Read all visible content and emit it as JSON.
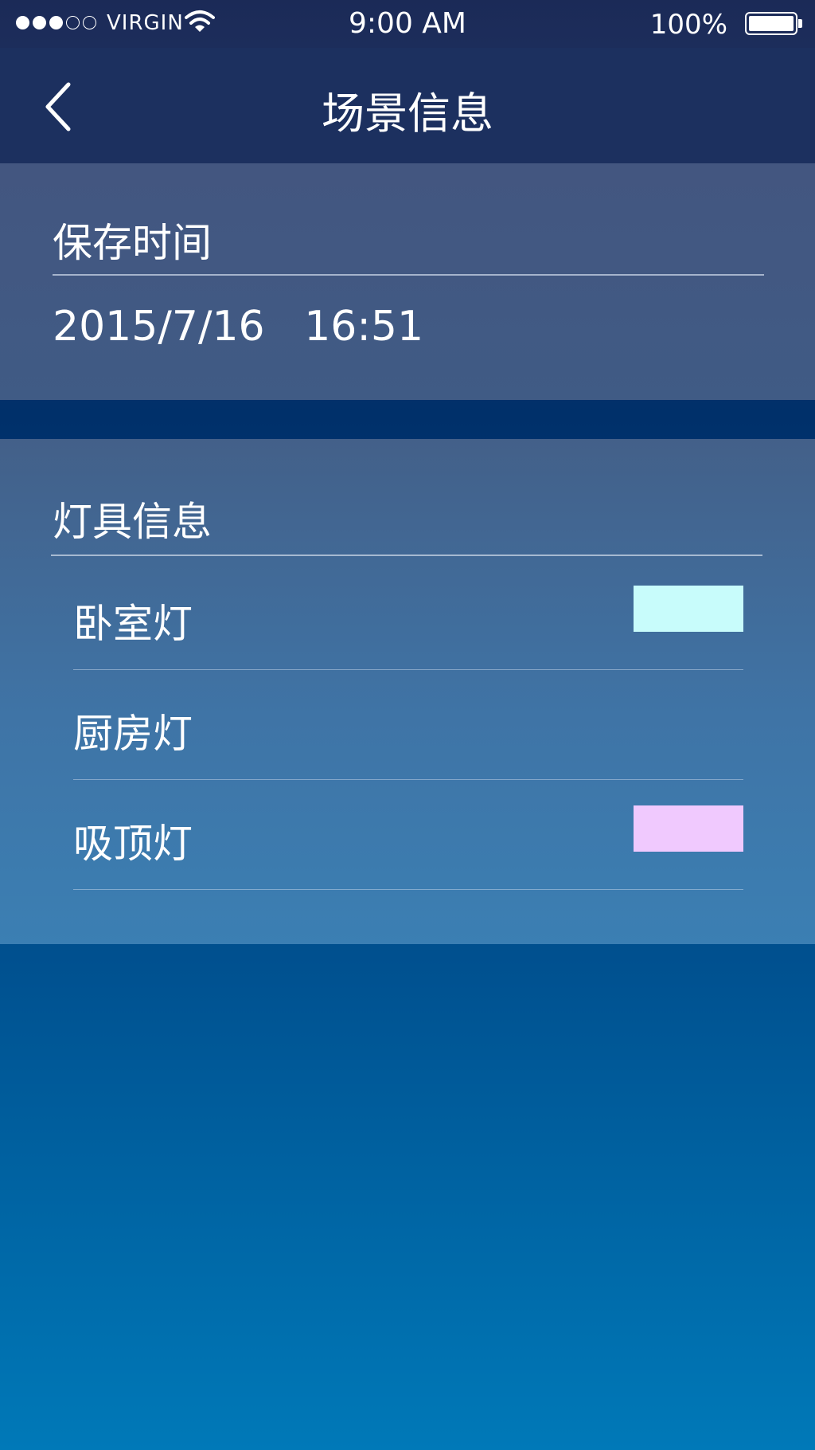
{
  "status_bar": {
    "carrier": "VIRGIN",
    "time": "9:00 AM",
    "battery": "100%",
    "signal_bars_filled": 3,
    "signal_bars_total": 5
  },
  "nav": {
    "title": "场景信息",
    "back_icon": "chevron-left-icon"
  },
  "save_time": {
    "heading": "保存时间",
    "value": "2015/7/16   16:51"
  },
  "lamps": {
    "heading": "灯具信息",
    "items": [
      {
        "name": "卧室灯",
        "color": "#c8fcfb"
      },
      {
        "name": "厨房灯",
        "color": ""
      },
      {
        "name": "吸顶灯",
        "color": "#f0c9fe"
      }
    ]
  }
}
